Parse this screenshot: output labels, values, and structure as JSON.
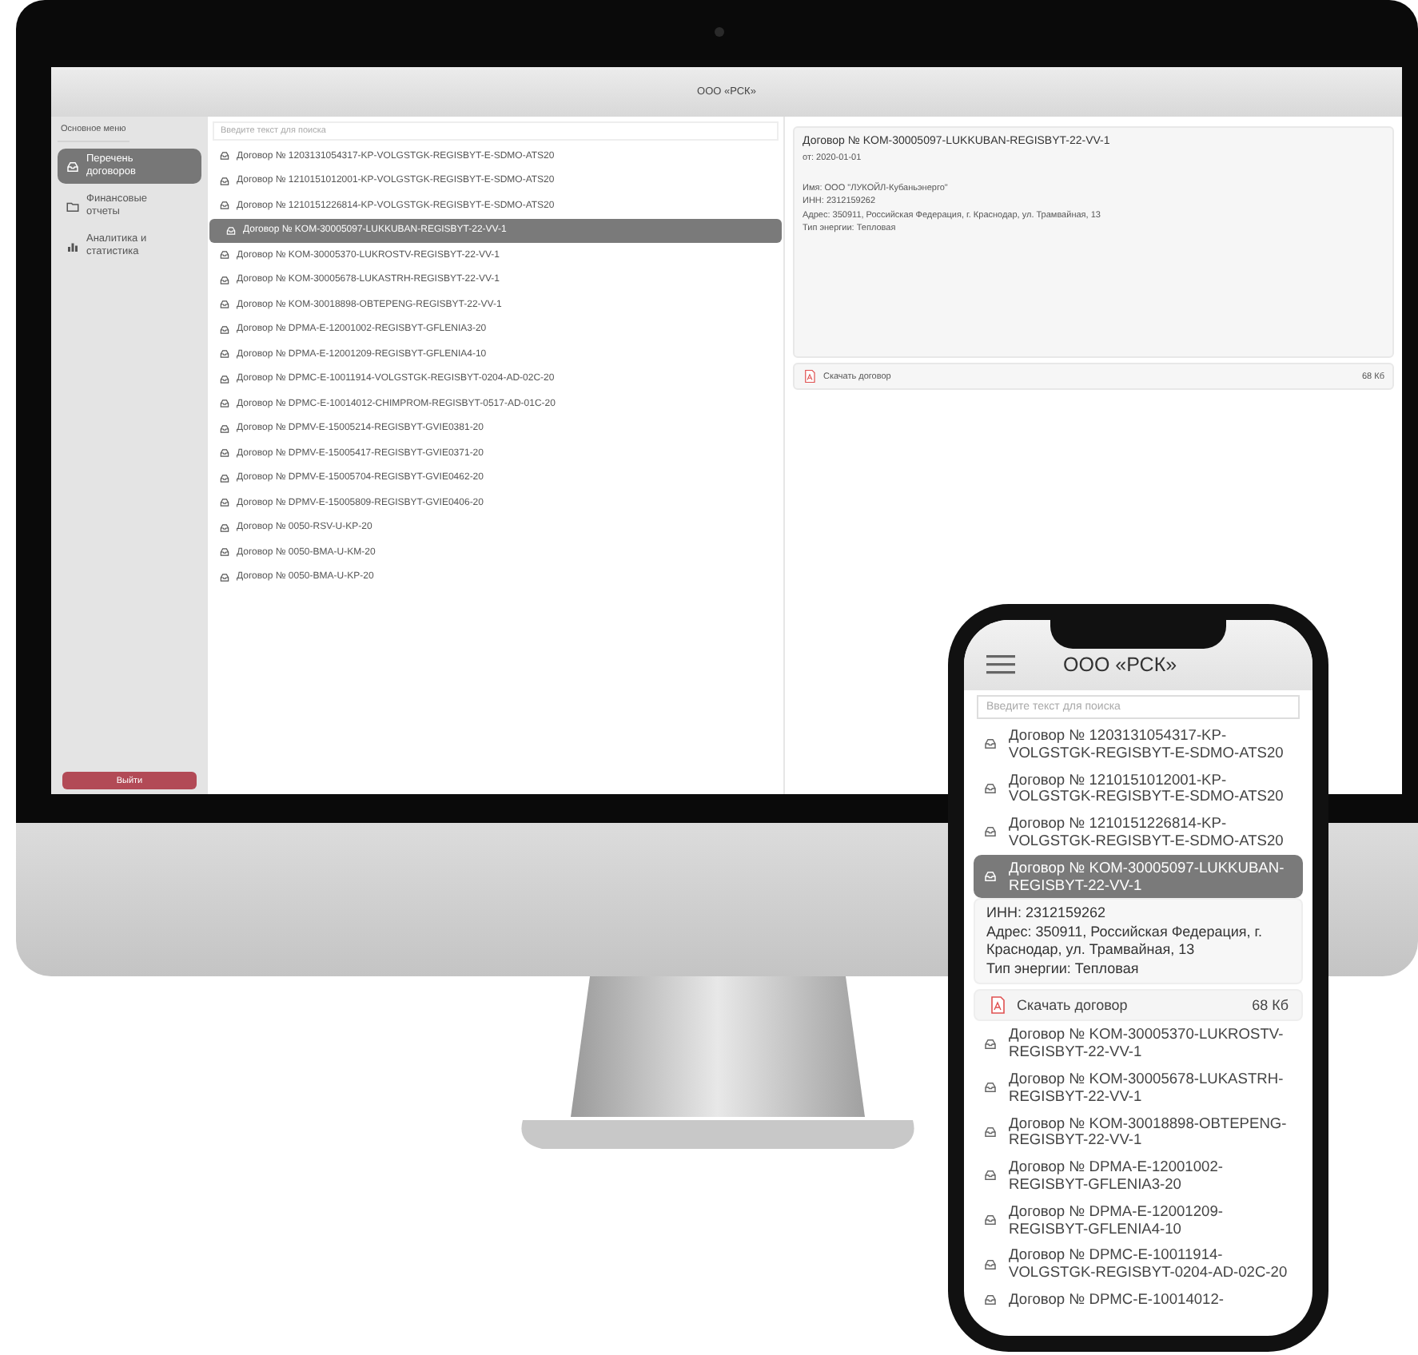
{
  "desktop": {
    "title": "ООО «РСК»",
    "sidebar": {
      "heading": "Основное меню",
      "items": [
        {
          "label": "Перечень договоров",
          "kind": "inbox",
          "selected": true
        },
        {
          "label": "Финансовые отчеты",
          "kind": "folder",
          "selected": false
        },
        {
          "label": "Аналитика и статистика",
          "kind": "chart",
          "selected": false
        }
      ],
      "logout": "Выйти"
    },
    "search": {
      "placeholder": "Введите текст для поиска"
    },
    "contracts": [
      {
        "label": "Договор № 1203131054317-KP-VOLGSTGK-REGISBYT-E-SDMO-ATS20",
        "selected": false
      },
      {
        "label": "Договор № 1210151012001-KP-VOLGSTGK-REGISBYT-E-SDMO-ATS20",
        "selected": false
      },
      {
        "label": "Договор № 1210151226814-KP-VOLGSTGK-REGISBYT-E-SDMO-ATS20",
        "selected": false
      },
      {
        "label": "Договор № KOM-30005097-LUKKUBAN-REGISBYT-22-VV-1",
        "selected": true
      },
      {
        "label": "Договор № KOM-30005370-LUKROSTV-REGISBYT-22-VV-1",
        "selected": false
      },
      {
        "label": "Договор № KOM-30005678-LUKASTRH-REGISBYT-22-VV-1",
        "selected": false
      },
      {
        "label": "Договор № KOM-30018898-OBTEPENG-REGISBYT-22-VV-1",
        "selected": false
      },
      {
        "label": "Договор № DPMA-E-12001002-REGISBYT-GFLENIA3-20",
        "selected": false
      },
      {
        "label": "Договор № DPMA-E-12001209-REGISBYT-GFLENIA4-10",
        "selected": false
      },
      {
        "label": "Договор № DPMC-E-10011914-VOLGSTGK-REGISBYT-0204-AD-02C-20",
        "selected": false
      },
      {
        "label": "Договор № DPMC-E-10014012-CHIMPROM-REGISBYT-0517-AD-01C-20",
        "selected": false
      },
      {
        "label": "Договор № DPMV-E-15005214-REGISBYT-GVIE0381-20",
        "selected": false
      },
      {
        "label": "Договор № DPMV-E-15005417-REGISBYT-GVIE0371-20",
        "selected": false
      },
      {
        "label": "Договор № DPMV-E-15005704-REGISBYT-GVIE0462-20",
        "selected": false
      },
      {
        "label": "Договор № DPMV-E-15005809-REGISBYT-GVIE0406-20",
        "selected": false
      },
      {
        "label": "Договор № 0050-RSV-U-KP-20",
        "selected": false
      },
      {
        "label": "Договор № 0050-BMA-U-KM-20",
        "selected": false
      },
      {
        "label": "Договор № 0050-BMA-U-KP-20",
        "selected": false
      }
    ],
    "detail": {
      "title": "Договор № KOM-30005097-LUKKUBAN-REGISBYT-22-VV-1",
      "date": "от: 2020-01-01",
      "fields": [
        "Имя: ООО \"ЛУКОЙЛ-Кубаньэнерго\"",
        "ИНН: 2312159262",
        "Адрес: 350911, Российская Федерация, г. Краснодар, ул. Трамвайная, 13",
        "Тип энергии: Тепловая"
      ],
      "download": {
        "label": "Скачать договор",
        "size": "68 Кб"
      }
    }
  },
  "phone": {
    "title": "ООО «РСК»",
    "search": {
      "placeholder": "Введите текст для поиска"
    },
    "contracts": [
      {
        "label": "Договор № 1203131054317-KP-VOLGSTGK-REGISBYT-E-SDMO-ATS20",
        "selected": false
      },
      {
        "label": "Договор № 1210151012001-KP-VOLGSTGK-REGISBYT-E-SDMO-ATS20",
        "selected": false
      },
      {
        "label": "Договор № 1210151226814-KP-VOLGSTGK-REGISBYT-E-SDMO-ATS20",
        "selected": false
      },
      {
        "label": "Договор № KOM-30005097-LUKKUBAN-REGISBYT-22-VV-1",
        "selected": true
      },
      {
        "label": "Договор № KOM-30005370-LUKROSTV-REGISBYT-22-VV-1",
        "selected": false
      },
      {
        "label": "Договор № KOM-30005678-LUKASTRH-REGISBYT-22-VV-1",
        "selected": false
      },
      {
        "label": "Договор № KOM-30018898-OBTEPENG-REGISBYT-22-VV-1",
        "selected": false
      },
      {
        "label": "Договор № DPMA-E-12001002-REGISBYT-GFLENIA3-20",
        "selected": false
      },
      {
        "label": "Договор № DPMA-E-12001209-REGISBYT-GFLENIA4-10",
        "selected": false
      },
      {
        "label": "Договор № DPMC-E-10011914-VOLGSTGK-REGISBYT-0204-AD-02C-20",
        "selected": false
      },
      {
        "label": "Договор № DPMC-E-10014012-",
        "selected": false
      }
    ],
    "details": {
      "fields": [
        "ИНН: 2312159262",
        "Адрес: 350911, Российская Федерация, г. Краснодар, ул. Трамвайная, 13",
        "Тип энергии: Тепловая"
      ],
      "download": {
        "label": "Скачать договор",
        "size": "68 Кб"
      }
    }
  }
}
